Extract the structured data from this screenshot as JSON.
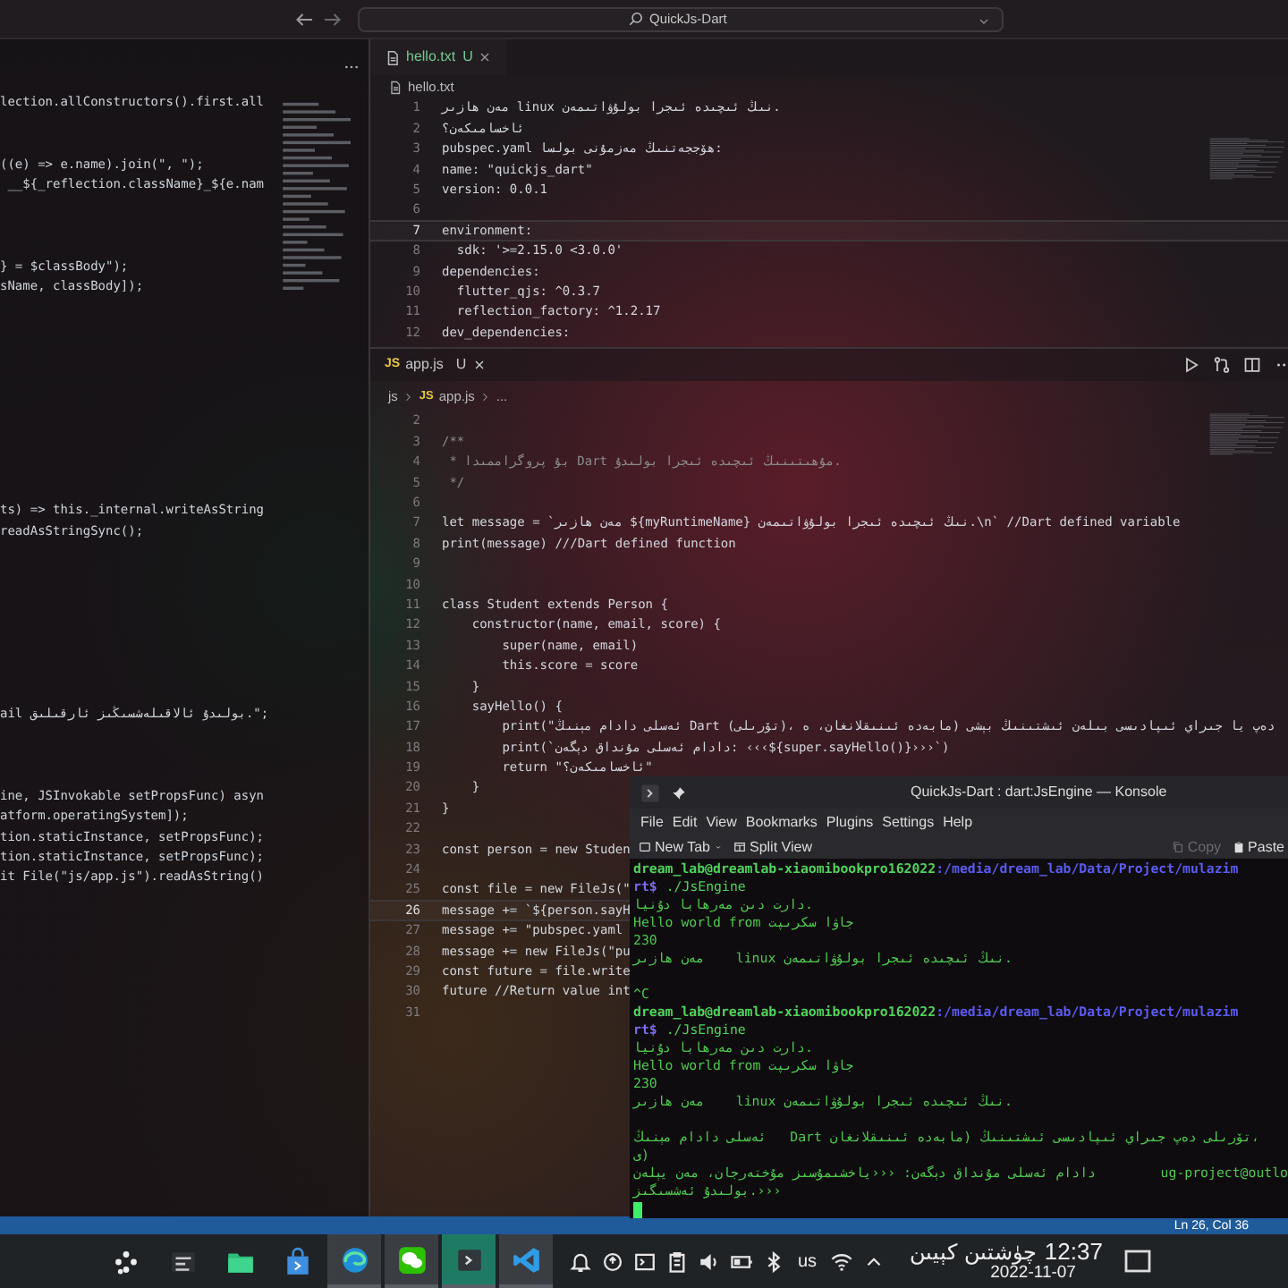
{
  "titlebar": {
    "search": "QuickJs-Dart"
  },
  "left_editor": {
    "lines": [
      {
        "text": "lection.allConstructors().first.all"
      },
      {
        "text": "((e) => e.name).join(\", \");"
      },
      {
        "text": " __${_reflection.className}_${e.nam"
      },
      {
        "text": "} = $classBody\");"
      },
      {
        "text": "sName, classBody]);"
      },
      {
        "text": "ts) => this._internal.writeAsString"
      },
      {
        "text": "readAsStringSync();"
      },
      {
        "text": "ail بولىدۇ ئالاقىلەشسىڭىز ئارقىلىق.\";"
      },
      {
        "text": "ine, JSInvokable setPropsFunc) asyn"
      },
      {
        "text": "atform.operatingSystem]);"
      },
      {
        "text": "tion.staticInstance, setPropsFunc);"
      },
      {
        "text": "tion.staticInstance, setPropsFunc);"
      },
      {
        "text": "it File(\"js/app.js\").readAsString()"
      }
    ]
  },
  "hello_editor": {
    "tab": {
      "label": "hello.txt",
      "status": "U"
    },
    "breadcrumb": "hello.txt",
    "lines": [
      {
        "number": "1",
        "text": "مەن ھازىر linux نىڭ ئىچىدە ئىجرا بولۇۋاتىمەن.",
        "current": false
      },
      {
        "number": "2",
        "text": "ئاخسامىكەن؟",
        "current": false
      },
      {
        "number": "3",
        "text": "pubspec.yaml ھۆججەتنىڭ مەزمۇنى بولسا:",
        "current": false
      },
      {
        "number": "4",
        "text": "name: \"quickjs_dart\"",
        "current": false
      },
      {
        "number": "5",
        "text": "version: 0.0.1",
        "current": false
      },
      {
        "number": "6",
        "current": false
      },
      {
        "number": "7",
        "text": "environment:",
        "current": true
      },
      {
        "number": "8",
        "text": "  sdk: '>=2.15.0 <3.0.0'",
        "current": false
      },
      {
        "number": "9",
        "text": "dependencies:",
        "current": false
      },
      {
        "number": "10",
        "text": "  flutter_qjs: ^0.3.7",
        "current": false
      },
      {
        "number": "11",
        "text": "  reflection_factory: ^1.2.17",
        "current": false
      },
      {
        "number": "12",
        "text": "dev_dependencies:",
        "current": false
      }
    ]
  },
  "app_editor": {
    "tab": {
      "badge": "JS",
      "label": "app.js",
      "status": "U"
    },
    "breadcrumb": [
      {
        "text": "js"
      },
      {
        "badge": "JS",
        "text": "app.js"
      },
      {
        "text": "..."
      }
    ],
    "lines": [
      {
        "number": "2",
        "current": false
      },
      {
        "number": "3",
        "text": "/**",
        "kind": "comment",
        "current": false
      },
      {
        "number": "4",
        "text": " * بۇ پروگراممىدا Dart مۇھىتىنىڭ ئىچىدە ئىجرا بولىدۇ.",
        "kind": "comment",
        "current": false
      },
      {
        "number": "5",
        "text": " */",
        "kind": "comment",
        "current": false
      },
      {
        "number": "6",
        "current": false
      },
      {
        "number": "7",
        "text": "let message = `مەن ھازىر ${myRuntimeName} نىڭ ئىچىدە ئىجرا بولۇۋاتىمەن.\\n` //Dart defined variable",
        "current": false
      },
      {
        "number": "8",
        "text": "print(message) ///Dart defined function",
        "current": false
      },
      {
        "number": "9",
        "current": false
      },
      {
        "number": "10",
        "current": false
      },
      {
        "number": "11",
        "text": "class Student extends Person {",
        "current": false
      },
      {
        "number": "12",
        "text": "    constructor(name, email, score) {",
        "current": false
      },
      {
        "number": "13",
        "text": "        super(name, email)",
        "current": false
      },
      {
        "number": "14",
        "text": "        this.score = score",
        "current": false
      },
      {
        "number": "15",
        "text": "    }",
        "current": false
      },
      {
        "number": "16",
        "text": "    sayHello() {",
        "current": false
      },
      {
        "number": "17",
        "text": "        print(\"ئەسلى دادام مېنىڭ Dart (تۆرىلى)، دەپ يا جىراي ئىپادىسى بىلەن ئىشتىنىڭ بېشى (مابەدە ئىنىقلانغان، ه",
        "current": false
      },
      {
        "number": "18",
        "text": "        print(`دادام ئەسلى مۇنداق دېگەن: ‹‹‹${super.sayHello()}›››`)",
        "current": false
      },
      {
        "number": "19",
        "text": "        return \"ئاخسامىكەن؟\"",
        "current": false
      },
      {
        "number": "20",
        "text": "    }",
        "current": false
      },
      {
        "number": "21",
        "text": "}",
        "current": false
      },
      {
        "number": "22",
        "current": false
      },
      {
        "number": "23",
        "text": "const person = new Studen",
        "current": false
      },
      {
        "number": "24",
        "current": false
      },
      {
        "number": "25",
        "text": "const file = new FileJs(\"",
        "current": false
      },
      {
        "number": "26",
        "text": "message += `${person.sayH",
        "current": true
      },
      {
        "number": "27",
        "text": "message += \"pubspec.yaml ",
        "current": false
      },
      {
        "number": "28",
        "text": "message += new FileJs(\"pu",
        "current": false
      },
      {
        "number": "29",
        "text": "const future = file.write",
        "current": false
      },
      {
        "number": "30",
        "text": "future //Return value int",
        "current": false
      },
      {
        "number": "31",
        "current": false
      }
    ]
  },
  "status_bar": {
    "position": "Ln 26, Col 36"
  },
  "konsole": {
    "title": "QuickJs-Dart : dart:JsEngine — Konsole",
    "menu": [
      "File",
      "Edit",
      "View",
      "Bookmarks",
      "Plugins",
      "Settings",
      "Help"
    ],
    "toolbar": [
      {
        "kind": "new-tab",
        "label": "New Tab",
        "disabled": false
      },
      {
        "kind": "split",
        "label": "Split View",
        "disabled": false
      },
      {
        "kind": "copy",
        "label": "Copy",
        "disabled": true
      },
      {
        "kind": "paste",
        "label": "Paste",
        "disabled": false
      }
    ],
    "lines": [
      {
        "kind": "prompt",
        "user": "dream_lab@dreamlab-xiaomibookpro162022",
        "path": ":/media/dream_lab/Data/Project/mulazim"
      },
      {
        "kind": "command",
        "prompt": "rt$",
        "text": "./JsEngine"
      },
      {
        "kind": "output",
        "text": "دارت دىن مەرھابا دۇنيا."
      },
      {
        "kind": "output",
        "text": "Hello world from جاۋا سكرىپت"
      },
      {
        "kind": "output",
        "text": "230"
      },
      {
        "kind": "output",
        "text": "مەن ھازىر    linux نىڭ ئىچىدە ئىجرا بولۇۋاتىمەن."
      },
      {
        "kind": "blank"
      },
      {
        "kind": "output",
        "text": "^C"
      },
      {
        "kind": "prompt",
        "user": "dream_lab@dreamlab-xiaomibookpro162022",
        "path": ":/media/dream_lab/Data/Project/mulazim"
      },
      {
        "kind": "command",
        "prompt": "rt$",
        "text": "./JsEngine"
      },
      {
        "kind": "output",
        "text": "دارت دىن مەرھابا دۇنيا."
      },
      {
        "kind": "output",
        "text": "Hello world from جاۋا سكرىپت"
      },
      {
        "kind": "output",
        "text": "230"
      },
      {
        "kind": "output",
        "text": "مەن ھازىر    linux نىڭ ئىچىدە ئىجرا بولۇۋاتىمەن."
      },
      {
        "kind": "blank"
      },
      {
        "kind": "output",
        "text": "ئەسلى دادام مېنىڭ   Dart تۆرىلى دەپ جىراي ئىپادىسى ئىشتىنىڭ (مابەدە ئىنىقلانغان،"
      },
      {
        "kind": "output",
        "text": "ى)"
      },
      {
        "kind": "output",
        "text": "دادام ئەسلى مۇنداق دېگەن: ‹‹‹ياخشىمۇسىز مۇختەرجان، مەن يېلەن",
        "right_text": "ug-project@outlo"
      },
      {
        "kind": "output",
        "text": "بولىدۇ ئەشسىگىز.›››"
      },
      {
        "kind": "cursor"
      }
    ]
  },
  "taskbar": {
    "apps": [
      {
        "kind": "launcher",
        "running": false,
        "selected": false
      },
      {
        "kind": "monitor",
        "running": false,
        "selected": false
      },
      {
        "kind": "folder",
        "running": false,
        "selected": false
      },
      {
        "kind": "store",
        "running": false,
        "selected": false
      },
      {
        "kind": "browser",
        "running": true,
        "selected": false
      },
      {
        "kind": "chat",
        "running": true,
        "selected": false
      },
      {
        "kind": "terminal",
        "running": true,
        "selected": true
      },
      {
        "kind": "code",
        "running": true,
        "selected": false
      }
    ],
    "tray": [
      {
        "kind": "bell"
      },
      {
        "kind": "update"
      },
      {
        "kind": "console"
      },
      {
        "kind": "clipboard"
      },
      {
        "kind": "volume"
      },
      {
        "kind": "battery"
      },
      {
        "kind": "bluetooth"
      },
      {
        "kind": "keyboard",
        "label": "us"
      },
      {
        "kind": "wifi"
      },
      {
        "kind": "expand"
      }
    ],
    "clock": {
      "period": "چۈشتىن كېيىن",
      "time": "12:37",
      "date": "2022-11-07"
    }
  }
}
